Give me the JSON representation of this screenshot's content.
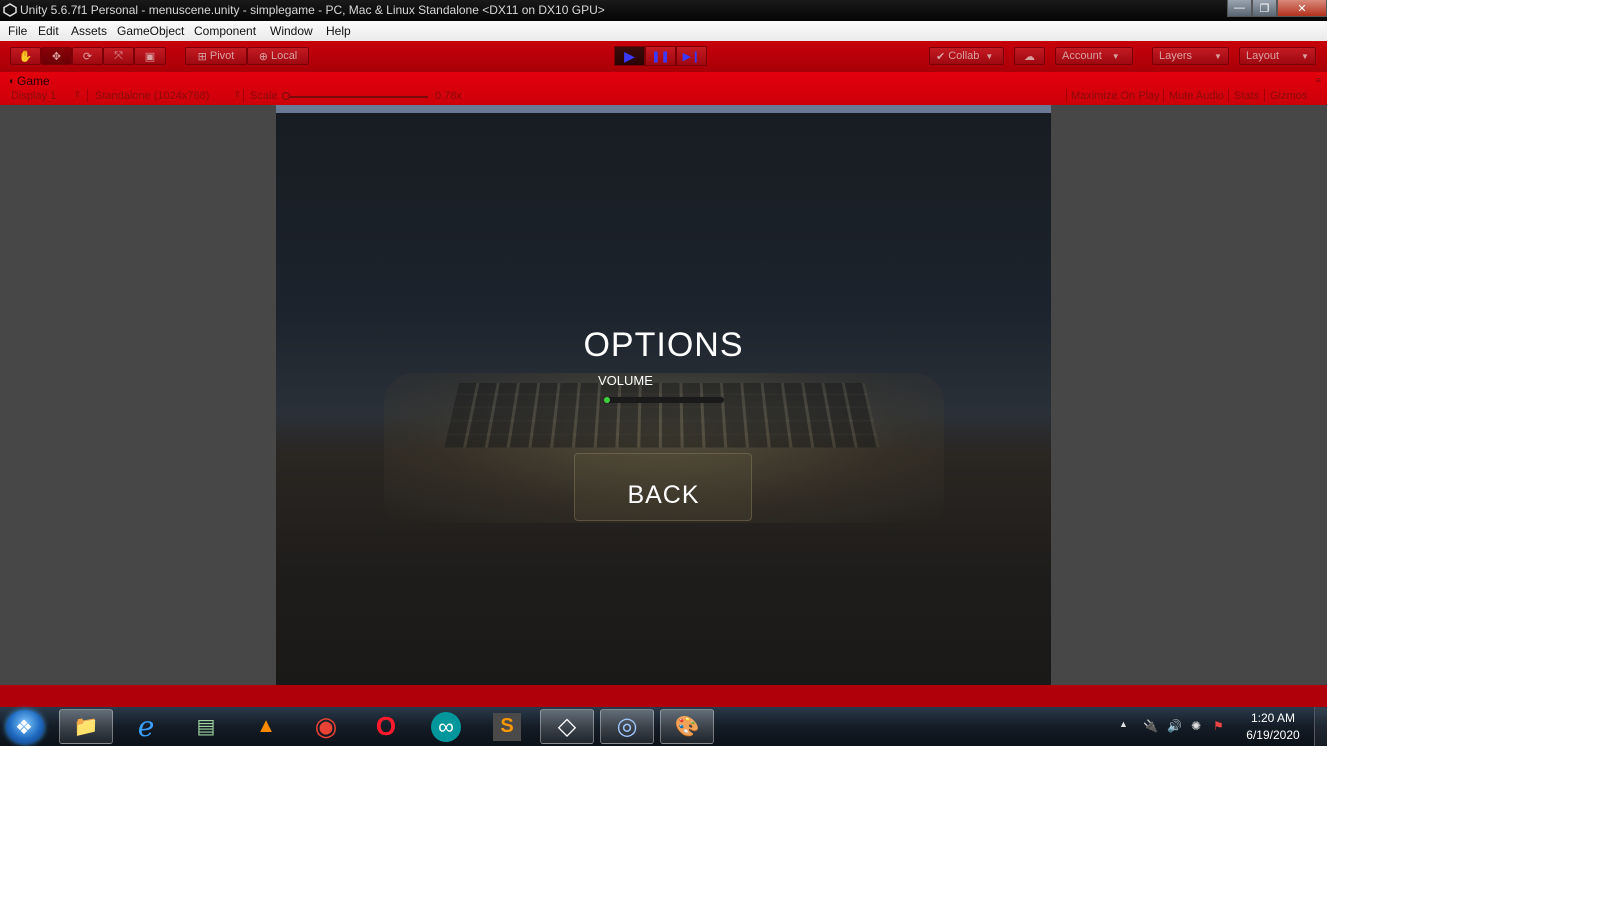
{
  "window": {
    "title": "Unity 5.6.7f1 Personal - menuscene.unity - simplegame - PC, Mac & Linux Standalone <DX11 on DX10 GPU>",
    "minimize": "—",
    "maximize": "❐",
    "close": "✕"
  },
  "menubar": [
    "File",
    "Edit",
    "Assets",
    "GameObject",
    "Component",
    "Window",
    "Help"
  ],
  "toolbar": {
    "hand_icon": "✋",
    "move_icon": "✥",
    "rotate_icon": "⟳",
    "scale_icon": "⤧",
    "rect_icon": "▣",
    "pivot_label": "Pivot",
    "local_label": "Local",
    "play_icon": "▶",
    "pause_icon": "❚❚",
    "step_icon": "▶❙",
    "collab_label": "Collab",
    "cloud_icon": "☁",
    "account_label": "Account",
    "layers_label": "Layers",
    "layout_label": "Layout"
  },
  "game_view": {
    "tab_label": "Game",
    "display": "Display 1",
    "resolution": "Standalone (1024x768)",
    "scale_label": "Scale",
    "scale_value": "0.78x",
    "maximize_on_play": "Maximize On Play",
    "mute_audio": "Mute Audio",
    "stats": "Stats",
    "gizmos": "Gizmos"
  },
  "game_ui": {
    "title": "OPTIONS",
    "volume_label": "VOLUME",
    "volume_value": 0.0,
    "back_label": "BACK"
  },
  "taskbar": {
    "apps": [
      {
        "name": "file-explorer",
        "glyph": "📁"
      },
      {
        "name": "internet-explorer",
        "glyph": "e"
      },
      {
        "name": "task-manager",
        "glyph": "▤"
      },
      {
        "name": "vlc",
        "glyph": "▲"
      },
      {
        "name": "chrome",
        "glyph": "◉"
      },
      {
        "name": "opera",
        "glyph": "O"
      },
      {
        "name": "arduino",
        "glyph": "∞"
      },
      {
        "name": "sublime-text",
        "glyph": "S"
      },
      {
        "name": "unity",
        "glyph": "◇"
      },
      {
        "name": "app-blue",
        "glyph": "◎"
      },
      {
        "name": "paint",
        "glyph": "🎨"
      }
    ],
    "time": "1:20 AM",
    "date": "6/19/2020"
  },
  "colors": {
    "toolbar_red": "#b0000a",
    "play_blue": "#3a3aff",
    "volume_knob": "#3cd23c"
  }
}
